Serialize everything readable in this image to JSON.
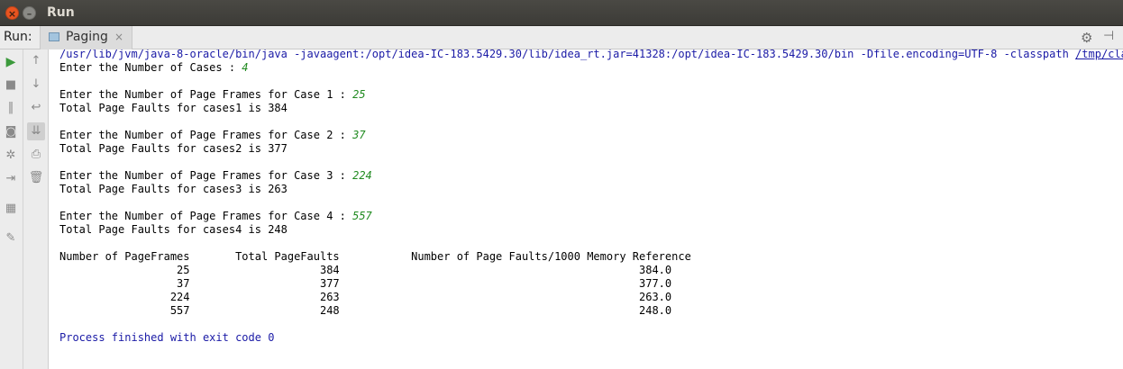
{
  "window": {
    "title": "Run"
  },
  "tabbar": {
    "run_label": "Run:",
    "tab_label": "Paging",
    "tab_close": "×"
  },
  "console": {
    "command": "/usr/lib/jvm/java-8-oracle/bin/java -javaagent:/opt/idea-IC-183.5429.30/lib/idea_rt.jar=41328:/opt/idea-IC-183.5429.30/bin -Dfile.encoding=UTF-8 -classpath ",
    "classpath_link": "/tmp/classpath",
    "prompt_cases": "Enter the Number of Cases : ",
    "input_cases": "4",
    "cases": [
      {
        "prompt": "Enter the Number of Page Frames for Case 1 : ",
        "input": "25",
        "result": "Total Page Faults for cases1 is 384"
      },
      {
        "prompt": "Enter the Number of Page Frames for Case 2 : ",
        "input": "37",
        "result": "Total Page Faults for cases2 is 377"
      },
      {
        "prompt": "Enter the Number of Page Frames for Case 3 : ",
        "input": "224",
        "result": "Total Page Faults for cases3 is 263"
      },
      {
        "prompt": "Enter the Number of Page Frames for Case 4 : ",
        "input": "557",
        "result": "Total Page Faults for cases4 is 248"
      }
    ],
    "table_header": "Number of PageFrames       Total PageFaults           Number of Page Faults/1000 Memory Reference",
    "table_rows": [
      "                  25                    384                                              384.0",
      "                  37                    377                                              377.0",
      "                 224                    263                                              263.0",
      "                 557                    248                                              248.0"
    ],
    "exit_message": "Process finished with exit code 0"
  }
}
